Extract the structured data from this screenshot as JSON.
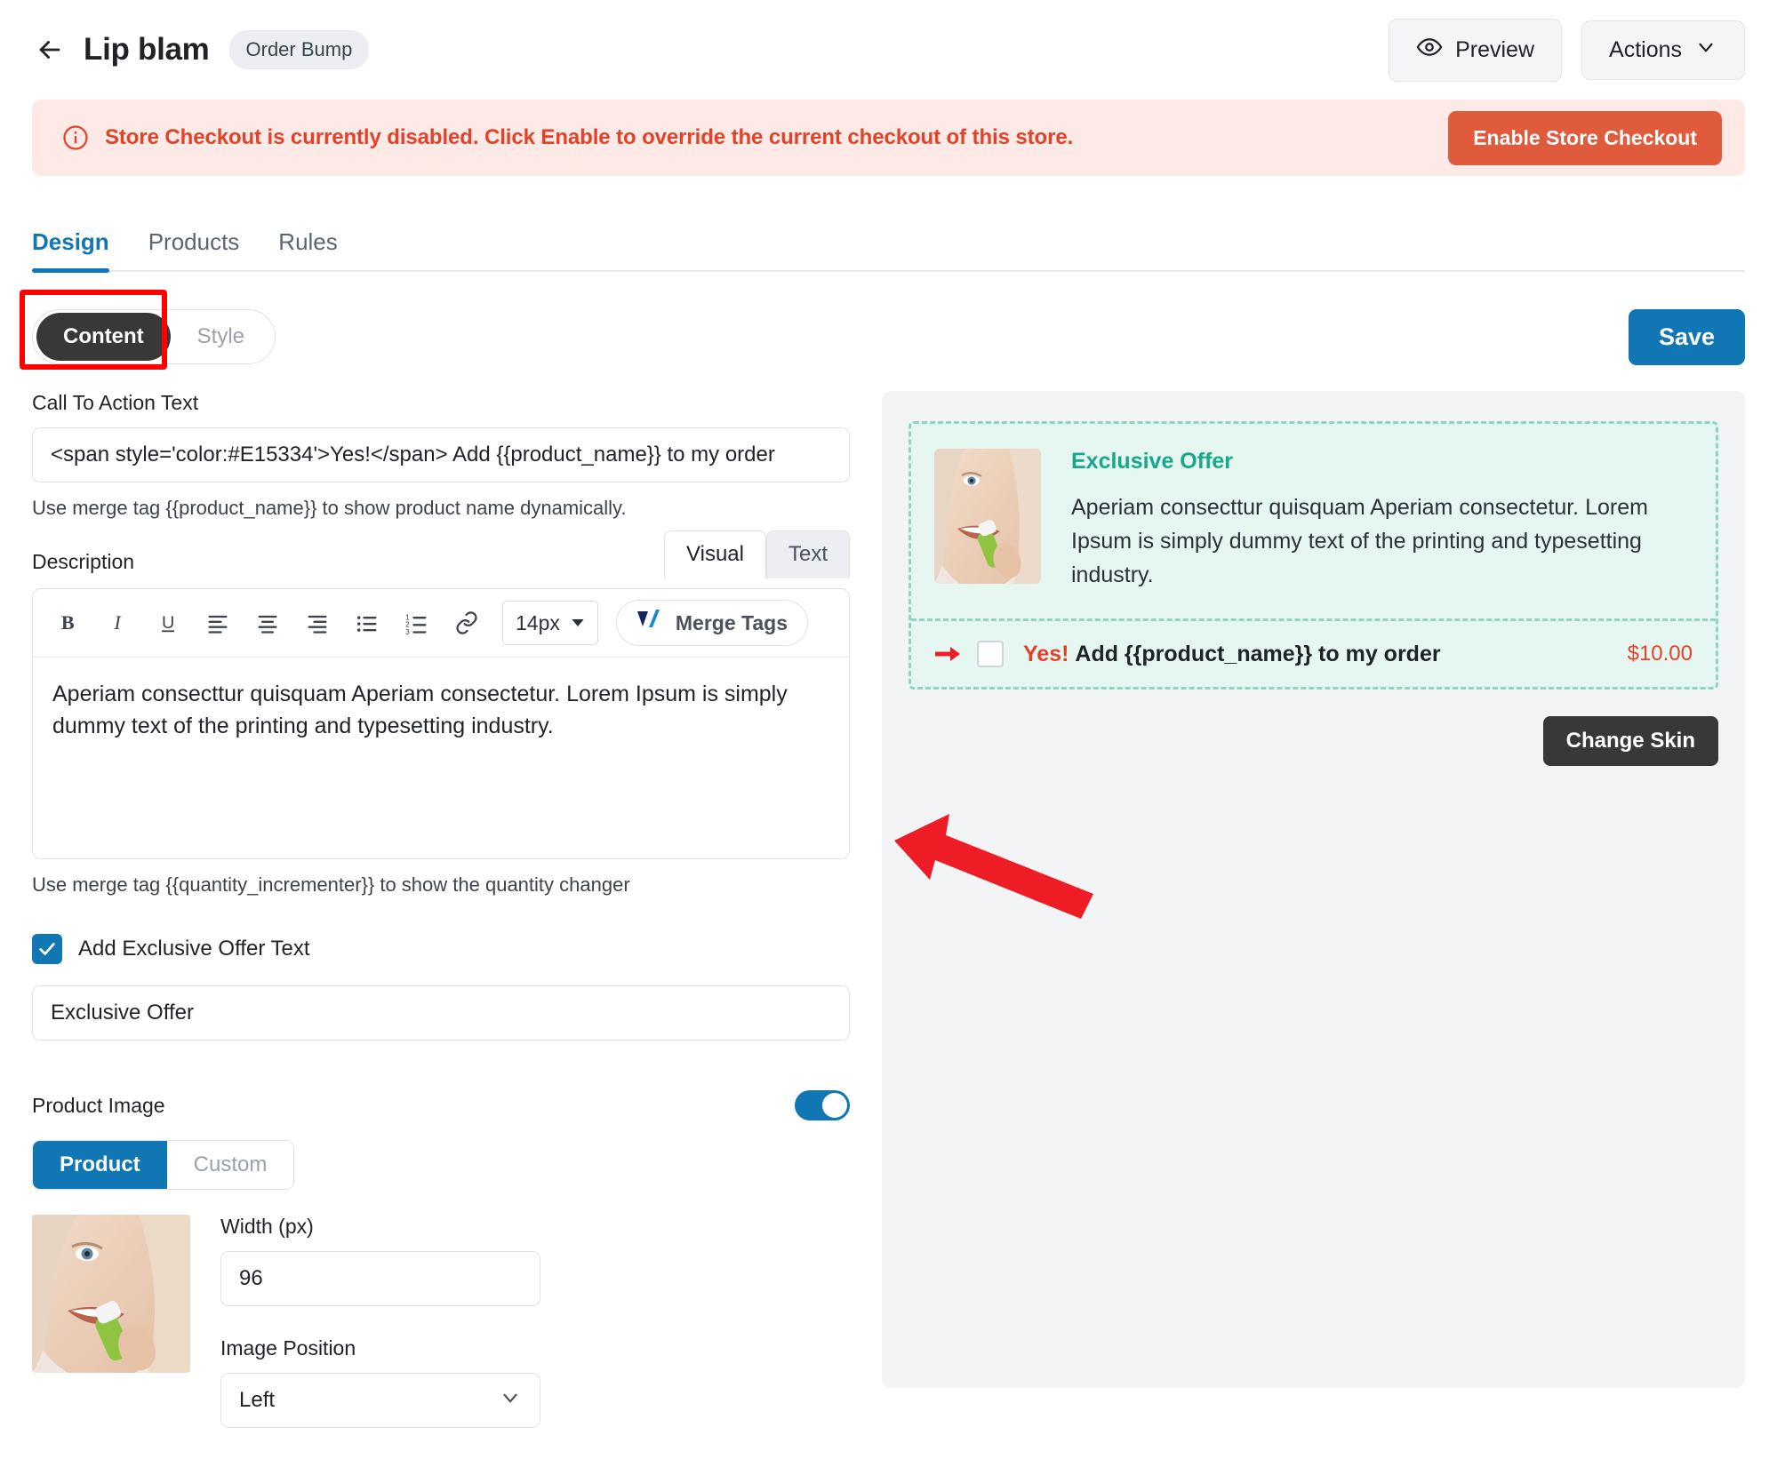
{
  "header": {
    "back_icon": "arrow-left-icon",
    "title": "Lip blam",
    "badge": "Order Bump",
    "preview_label": "Preview",
    "preview_icon": "eye-icon",
    "actions_label": "Actions",
    "actions_icon": "chevron-down-icon"
  },
  "alert": {
    "icon": "info-circle-icon",
    "message": "Store Checkout is currently disabled. Click Enable to override the current checkout of this store.",
    "button_label": "Enable Store Checkout",
    "bg_color": "#fdeae6",
    "text_color": "#e1432a",
    "button_color": "#e05a3c"
  },
  "tabs": [
    {
      "label": "Design",
      "active": true
    },
    {
      "label": "Products",
      "active": false
    },
    {
      "label": "Rules",
      "active": false
    }
  ],
  "subbar": {
    "segments": [
      {
        "label": "Content",
        "active": true
      },
      {
        "label": "Style",
        "active": false
      }
    ],
    "save_label": "Save",
    "save_color": "#1176b4",
    "highlight_color": "#ff0000"
  },
  "form": {
    "cta_label": "Call To Action Text",
    "cta_value": "<span style='color:#E15334'>Yes!</span> Add {{product_name}} to my order",
    "cta_hint": "Use merge tag {{product_name}} to show product name dynamically.",
    "description_label": "Description",
    "editor_tabs": [
      {
        "label": "Visual",
        "active": true
      },
      {
        "label": "Text",
        "active": false
      }
    ],
    "toolbar": {
      "bold": "B",
      "italic": "I",
      "underline": "U",
      "font_size": "14px",
      "merge_tags_label": "Merge Tags",
      "icons": [
        "bold-icon",
        "italic-icon",
        "underline-icon",
        "align-left-icon",
        "align-center-icon",
        "align-right-icon",
        "bullet-list-icon",
        "numbered-list-icon",
        "link-icon"
      ]
    },
    "description_value": "Aperiam consecttur quisquam Aperiam consectetur. Lorem Ipsum is simply dummy text of the printing and typesetting industry.",
    "description_hint": "Use merge tag {{quantity_incrementer}} to show the quantity changer",
    "exclusive_checkbox_label": "Add Exclusive Offer Text",
    "exclusive_checkbox_checked": true,
    "exclusive_offer_value": "Exclusive Offer",
    "product_image_label": "Product Image",
    "product_image_enabled": true,
    "image_source_segments": [
      {
        "label": "Product",
        "active": true
      },
      {
        "label": "Custom",
        "active": false
      }
    ],
    "width_label": "Width (px)",
    "width_value": "96",
    "image_position_label": "Image Position",
    "image_position_value": "Left"
  },
  "preview": {
    "offer_title": "Exclusive Offer",
    "offer_title_color": "#17a78a",
    "offer_description": "Aperiam consecttur quisquam Aperiam consectetur. Lorem Ipsum is simply dummy text of the printing and typesetting industry.",
    "cta_yes": "Yes!",
    "cta_rest": "Add {{product_name}} to my order",
    "cta_price": "$10.00",
    "cta_color": "#e1432a",
    "card_bg": "#e6f7f2",
    "card_border": "#8fd5c4",
    "change_skin_label": "Change Skin",
    "arrow_icon": "arrow-right-icon"
  },
  "annotation": {
    "pointer_icon": "red-arrow-annotation",
    "color": "#ee1c25"
  }
}
